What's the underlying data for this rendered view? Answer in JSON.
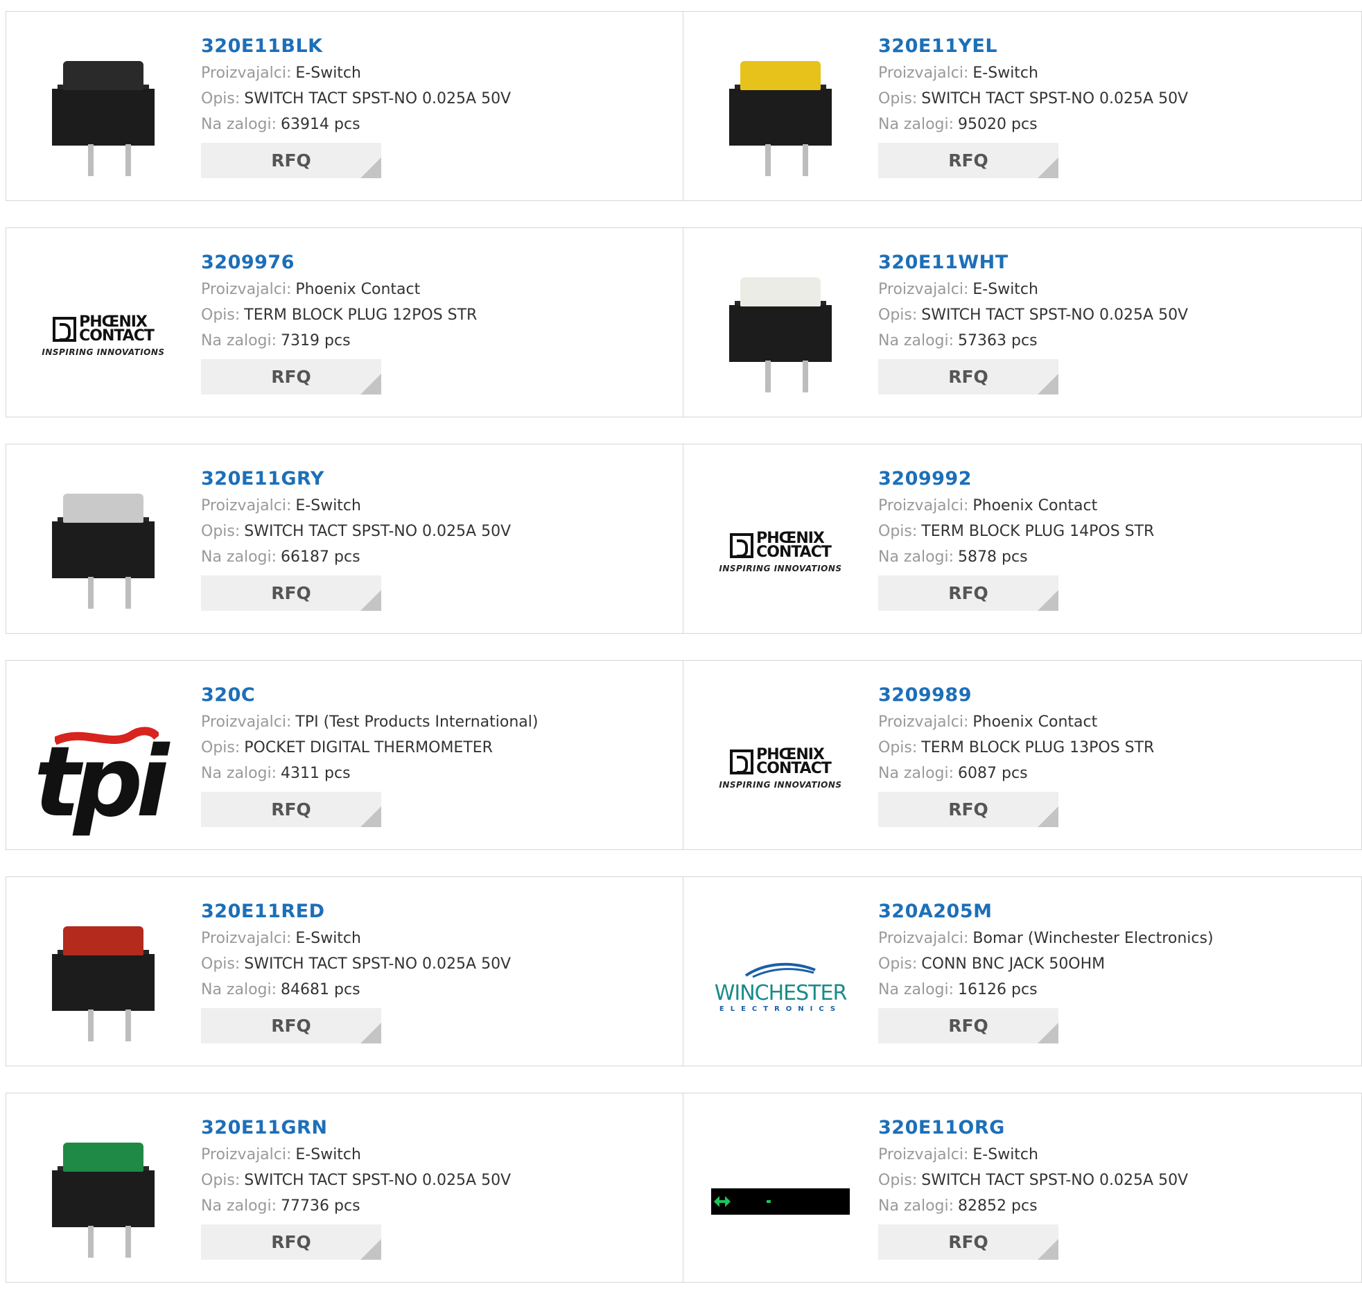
{
  "labels": {
    "manufacturer": "Proizvajalci:",
    "description": "Opis:",
    "stock": "Na zalogi:",
    "rfq": "RFQ"
  },
  "products": [
    {
      "pn": "320E11BLK",
      "manufacturer": "E-Switch",
      "description": "SWITCH TACT SPST-NO 0.025A 50V",
      "stock": "63914 pcs",
      "image": "switch-black",
      "cap_color": "#2a2a2a"
    },
    {
      "pn": "320E11YEL",
      "manufacturer": "E-Switch",
      "description": "SWITCH TACT SPST-NO 0.025A 50V",
      "stock": "95020 pcs",
      "image": "switch-yellow",
      "cap_color": "#e6c21a"
    },
    {
      "pn": "3209976",
      "manufacturer": "Phoenix Contact",
      "description": "TERM BLOCK PLUG 12POS STR",
      "stock": "7319 pcs",
      "image": "phoenix-contact-logo"
    },
    {
      "pn": "320E11WHT",
      "manufacturer": "E-Switch",
      "description": "SWITCH TACT SPST-NO 0.025A 50V",
      "stock": "57363 pcs",
      "image": "switch-white",
      "cap_color": "#ecece6"
    },
    {
      "pn": "320E11GRY",
      "manufacturer": "E-Switch",
      "description": "SWITCH TACT SPST-NO 0.025A 50V",
      "stock": "66187 pcs",
      "image": "switch-grey",
      "cap_color": "#c9c9c9"
    },
    {
      "pn": "3209992",
      "manufacturer": "Phoenix Contact",
      "description": "TERM BLOCK PLUG 14POS STR",
      "stock": "5878 pcs",
      "image": "phoenix-contact-logo"
    },
    {
      "pn": "320C",
      "manufacturer": "TPI (Test Products International)",
      "description": "POCKET DIGITAL THERMOMETER",
      "stock": "4311 pcs",
      "image": "tpi-logo"
    },
    {
      "pn": "3209989",
      "manufacturer": "Phoenix Contact",
      "description": "TERM BLOCK PLUG 13POS STR",
      "stock": "6087 pcs",
      "image": "phoenix-contact-logo"
    },
    {
      "pn": "320E11RED",
      "manufacturer": "E-Switch",
      "description": "SWITCH TACT SPST-NO 0.025A 50V",
      "stock": "84681 pcs",
      "image": "switch-red",
      "cap_color": "#b42a1c"
    },
    {
      "pn": "320A205M",
      "manufacturer": "Bomar (Winchester Electronics)",
      "description": "CONN BNC JACK 50OHM",
      "stock": "16126 pcs",
      "image": "winchester-logo"
    },
    {
      "pn": "320E11GRN",
      "manufacturer": "E-Switch",
      "description": "SWITCH TACT SPST-NO 0.025A 50V",
      "stock": "77736 pcs",
      "image": "switch-green",
      "cap_color": "#1f8a45"
    },
    {
      "pn": "320E11ORG",
      "manufacturer": "E-Switch",
      "description": "SWITCH TACT SPST-NO 0.025A 50V",
      "stock": "82852 pcs",
      "image": "lcd-display"
    }
  ],
  "logos": {
    "phoenix": {
      "line1": "PHŒNIX",
      "line2": "CONTACT",
      "tagline": "INSPIRING INNOVATIONS"
    },
    "tpi": {
      "text": "tpi"
    },
    "winchester": {
      "name": "WINCHESTER",
      "sub": "ELECTRONICS"
    }
  }
}
